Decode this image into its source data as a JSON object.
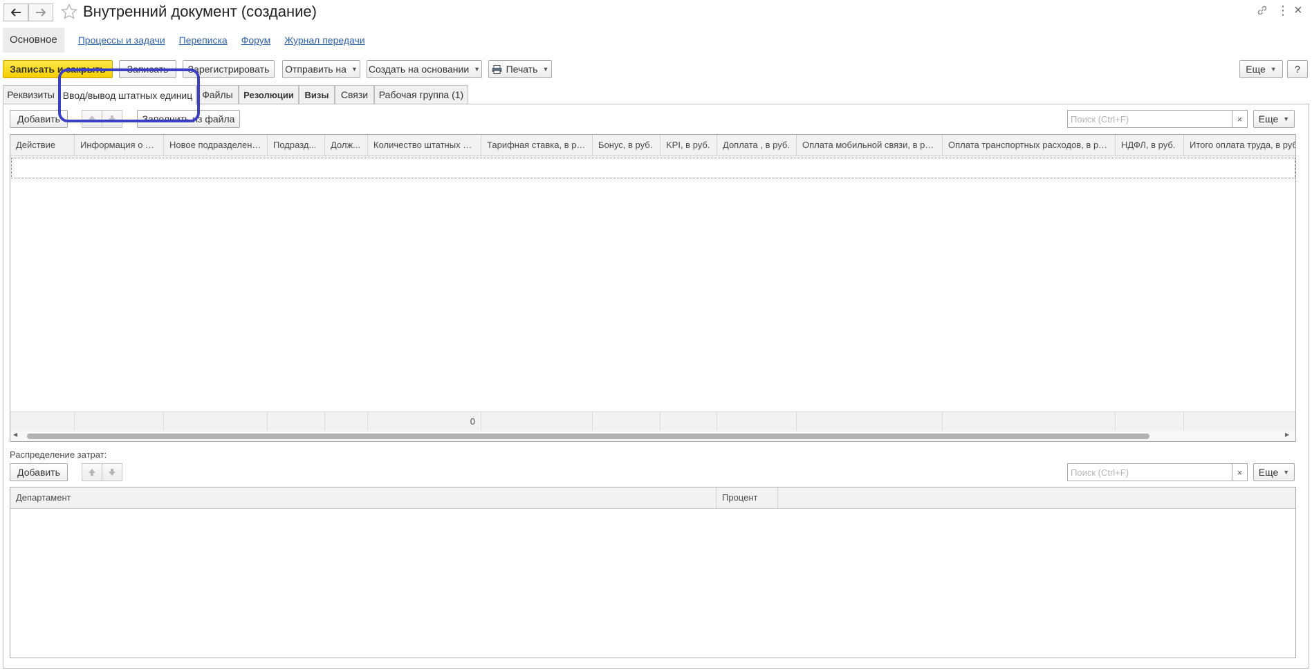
{
  "window": {
    "title": "Внутренний документ (создание)"
  },
  "sections": {
    "active": "Основное",
    "links": [
      "Процессы и задачи",
      "Переписка",
      "Форум",
      "Журнал передачи"
    ]
  },
  "toolbar": {
    "save_close": "Записать и закрыть",
    "save": "Записать",
    "register": "Зарегистрировать",
    "send": "Отправить на",
    "create_based": "Создать на основании",
    "print": "Печать",
    "more": "Еще",
    "help": "?"
  },
  "tabs": [
    "Реквизиты",
    "Ввод/вывод штатных единиц",
    "Файлы",
    "Резолюции",
    "Визы",
    "Связи",
    "Рабочая группа (1)"
  ],
  "staff_table": {
    "add": "Добавить",
    "fill_from_file": "Заполнить из файла",
    "search_placeholder": "Поиск (Ctrl+F)",
    "clear": "×",
    "more": "Еще",
    "columns": [
      "Действие",
      "Информация о д...",
      "Новое подразделение",
      "Подразд...",
      "Долж...",
      "Количество штатных ед.",
      "Тарифная ставка, в руб.",
      "Бонус, в руб.",
      "KPI, в руб.",
      "Доплата , в руб.",
      "Оплата мобильной связи, в руб.",
      "Оплата транспортных расходов, в руб.",
      "НДФЛ, в руб.",
      "Итого оплата труда, в руб."
    ],
    "totals": [
      "",
      "",
      "",
      "",
      "",
      "0",
      "",
      "",
      "",
      "",
      "",
      "",
      "",
      ""
    ]
  },
  "cost_distribution": {
    "label": "Распределение затрат:",
    "add": "Добавить",
    "search_placeholder": "Поиск (Ctrl+F)",
    "clear": "×",
    "more": "Еще",
    "columns": [
      "Департамент",
      "Процент"
    ]
  },
  "colors": {
    "primary_button": "#f7cf00",
    "link": "#2e63b0",
    "highlight": "#3a3fc4"
  }
}
